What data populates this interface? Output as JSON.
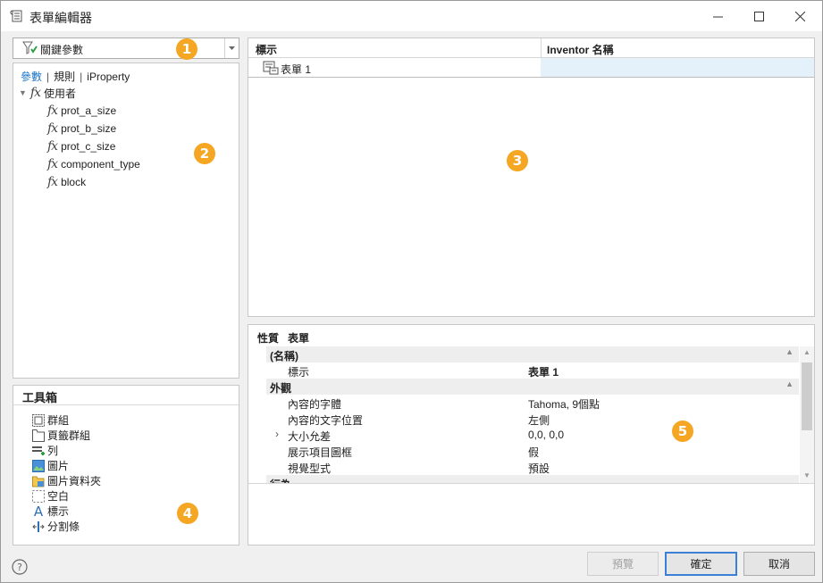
{
  "window": {
    "title": "表單編輯器"
  },
  "param_dropdown": {
    "selected": "關鍵參數"
  },
  "param_tree": {
    "tabs": [
      "參數",
      "規則",
      "iProperty"
    ],
    "group": "使用者",
    "fx_symbol": "fx",
    "items": [
      "prot_a_size",
      "prot_b_size",
      "prot_c_size",
      "component_type",
      "block"
    ]
  },
  "form_grid": {
    "headers": {
      "label": "標示",
      "inventor_name": "Inventor 名稱"
    },
    "rows": [
      {
        "label": "表單 1",
        "inventor_name": ""
      }
    ]
  },
  "properties": {
    "title": "性質",
    "subject": "表單",
    "categories": {
      "name": "(名稱)",
      "appearance": "外觀",
      "behavior": "行為"
    },
    "rows": [
      {
        "name": "標示",
        "value": "表單 1"
      },
      {
        "name": "內容的字體",
        "value": "Tahoma, 9個點"
      },
      {
        "name": "內容的文字位置",
        "value": "左側"
      },
      {
        "name": "大小允差",
        "value": "0,0, 0,0"
      },
      {
        "name": "展示項目圖框",
        "value": "假"
      },
      {
        "name": "視覺型式",
        "value": "預設"
      }
    ]
  },
  "toolbox": {
    "title": "工具箱",
    "items": [
      "群組",
      "頁籤群組",
      "列",
      "圖片",
      "圖片資料夾",
      "空白",
      "標示",
      "分割條"
    ]
  },
  "buttons": {
    "preview": "預覽",
    "ok": "確定",
    "cancel": "取消"
  },
  "callouts": [
    "1",
    "2",
    "3",
    "4",
    "5"
  ],
  "colors": {
    "accent": "#3c7fd6",
    "callout": "#f5a623",
    "link": "#1a73c8"
  }
}
